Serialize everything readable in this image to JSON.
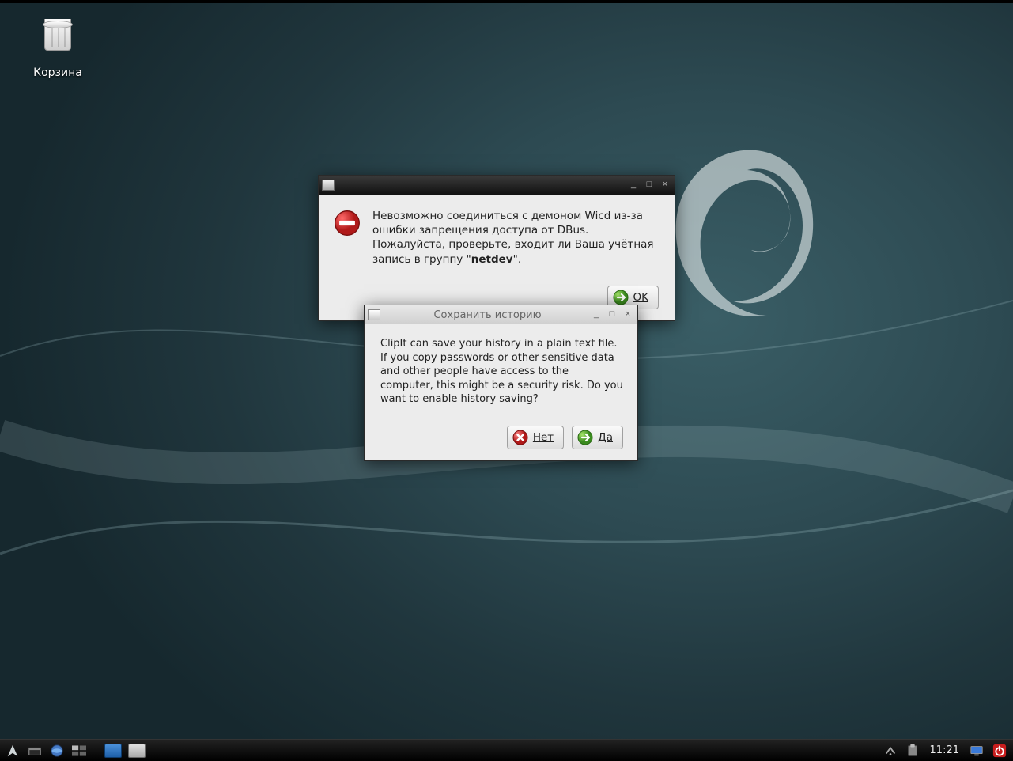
{
  "desktop": {
    "trash_label": "Корзина"
  },
  "dialog1": {
    "title": "",
    "message_pre": "Невозможно соединиться с демоном Wicd из-за ошибки запрещения доступа от DBus. Пожалуйста, проверьте, входит ли Ваша учётная запись в группу \"",
    "message_bold": "netdev",
    "message_post": "\".",
    "ok": "OK"
  },
  "dialog2": {
    "title": "Сохранить историю",
    "message": "ClipIt can save your history in a plain text file. If you copy passwords or other sensitive data and other people have access to the computer, this might be a security risk. Do you want to enable history saving?",
    "no": "Нет",
    "yes": "Да"
  },
  "taskbar": {
    "clock": "11:21"
  }
}
